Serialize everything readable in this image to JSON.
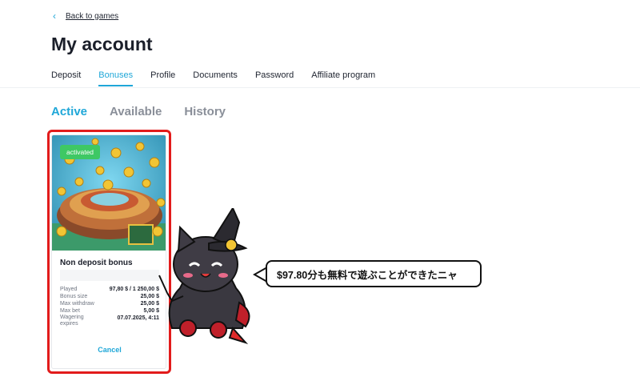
{
  "nav": {
    "back_label": "Back to games"
  },
  "page": {
    "title": "My account"
  },
  "tabs": [
    {
      "label": "Deposit"
    },
    {
      "label": "Bonuses",
      "active": true
    },
    {
      "label": "Profile"
    },
    {
      "label": "Documents"
    },
    {
      "label": "Password"
    },
    {
      "label": "Affiliate program"
    }
  ],
  "subtabs": [
    {
      "label": "Active",
      "active": true
    },
    {
      "label": "Available"
    },
    {
      "label": "History"
    }
  ],
  "bonus_card": {
    "badge": "activated",
    "name": "Non deposit bonus",
    "rows": [
      {
        "key": "Played",
        "value": "97,80 $ / 1 250,00 $"
      },
      {
        "key": "Bonus size",
        "value": "25,00 $"
      },
      {
        "key": "Max withdraw",
        "value": "25,00 $"
      },
      {
        "key": "Max bet",
        "value": "5,00 $"
      },
      {
        "key": "Wagering expires",
        "value": "07.07.2025, 4:11"
      }
    ],
    "cancel_label": "Cancel"
  },
  "speech_bubble": {
    "text": "$97.80分も無料で遊ぶことができたニャ"
  },
  "colors": {
    "accent": "#1fa7d8",
    "badge": "#3ec864",
    "highlight": "#e21b1b"
  }
}
